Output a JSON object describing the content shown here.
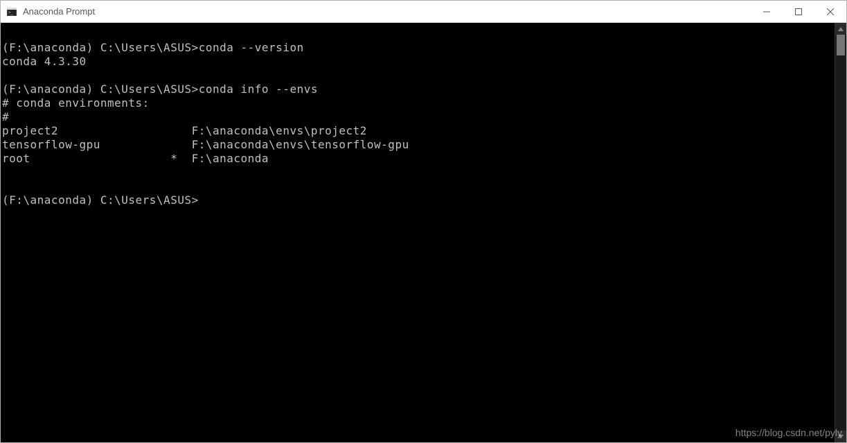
{
  "window": {
    "title": "Anaconda Prompt",
    "icon_glyph": "terminal-icon"
  },
  "terminal": {
    "lines": [
      {
        "text": ""
      },
      {
        "prompt": "(F:\\anaconda) C:\\Users\\ASUS>",
        "command": "conda --version"
      },
      {
        "text": "conda 4.3.30"
      },
      {
        "text": ""
      },
      {
        "prompt": "(F:\\anaconda) C:\\Users\\ASUS>",
        "command": "conda info --envs"
      },
      {
        "text": "# conda environments:"
      },
      {
        "text": "#"
      },
      {
        "env_name": "project2",
        "marker": " ",
        "path": "F:\\anaconda\\envs\\project2"
      },
      {
        "env_name": "tensorflow-gpu",
        "marker": " ",
        "path": "F:\\anaconda\\envs\\tensorflow-gpu"
      },
      {
        "env_name": "root",
        "marker": "*",
        "path": "F:\\anaconda"
      },
      {
        "text": ""
      },
      {
        "text": ""
      },
      {
        "prompt": "(F:\\anaconda) C:\\Users\\ASUS>",
        "command": "",
        "cursor": true
      }
    ]
  },
  "watermark": "https://blog.csdn.net/pyly"
}
